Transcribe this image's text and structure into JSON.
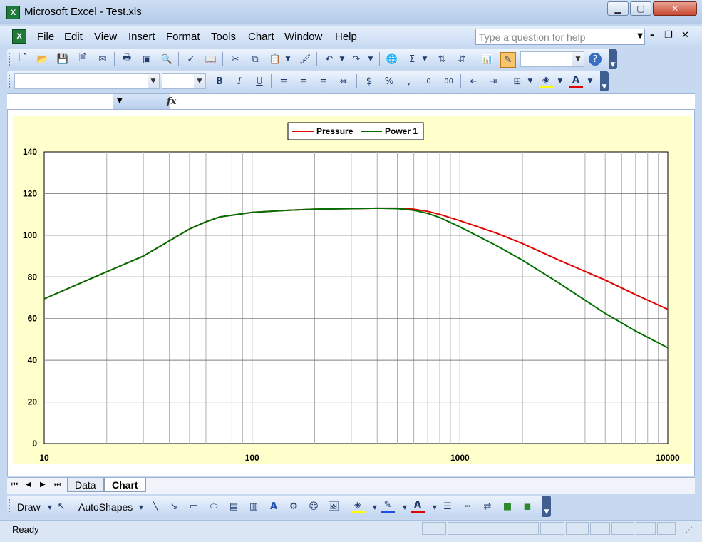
{
  "window": {
    "title": "Microsoft Excel - Test.xls",
    "icon": "excel-icon",
    "min_glyph": "▁",
    "max_glyph": "▢",
    "close_glyph": "✕"
  },
  "menu": {
    "items": [
      "File",
      "Edit",
      "View",
      "Insert",
      "Format",
      "Tools",
      "Chart",
      "Window",
      "Help"
    ],
    "help_placeholder": "Type a question for help",
    "mdi_min": "–",
    "mdi_restore": "❐",
    "mdi_close": "✕"
  },
  "formula_bar": {
    "fx": "fx",
    "name_value": "",
    "formula_value": ""
  },
  "chart_data": {
    "type": "line",
    "title": "",
    "xlabel": "",
    "ylabel": "",
    "x_scale": "log",
    "xlim": [
      10,
      10000
    ],
    "ylim": [
      0,
      140
    ],
    "x_ticks": [
      "10",
      "100",
      "1000",
      "10000"
    ],
    "y_ticks": [
      "0",
      "20",
      "40",
      "60",
      "80",
      "100",
      "120",
      "140"
    ],
    "grid": true,
    "legend_position": "top-center",
    "series": [
      {
        "name": "Pressure",
        "color": "#e00000",
        "x": [
          10,
          20,
          30,
          50,
          60,
          70,
          100,
          150,
          200,
          300,
          400,
          500,
          600,
          700,
          800,
          1000,
          1500,
          2000,
          3000,
          5000,
          7000,
          10000
        ],
        "y": [
          69.5,
          82.5,
          90,
          103,
          106.5,
          108.8,
          111,
          112,
          112.5,
          112.8,
          113,
          113,
          112.5,
          111.5,
          110,
          107,
          101,
          96,
          88,
          78.5,
          71.5,
          64.5
        ]
      },
      {
        "name": "Power 1",
        "color": "#007000",
        "x": [
          10,
          20,
          30,
          50,
          60,
          70,
          100,
          150,
          200,
          300,
          400,
          500,
          600,
          700,
          800,
          1000,
          1500,
          2000,
          3000,
          5000,
          7000,
          10000
        ],
        "y": [
          69.5,
          82.5,
          90,
          103,
          106.5,
          108.8,
          111,
          112,
          112.5,
          112.8,
          113,
          112.8,
          112,
          110.5,
          108.5,
          104,
          95,
          88,
          77,
          62.5,
          54,
          46
        ]
      }
    ]
  },
  "sheet_tabs": {
    "tabs": [
      "Data",
      "Chart"
    ],
    "active": "Chart"
  },
  "drawing_toolbar": {
    "draw_label": "Draw",
    "autoshapes_label": "AutoShapes"
  },
  "status": {
    "text": "Ready"
  },
  "colors": {
    "chart_background": "#ffffcc",
    "plot_background": "#ffffff",
    "pressure": "#e00000",
    "power": "#007000"
  }
}
